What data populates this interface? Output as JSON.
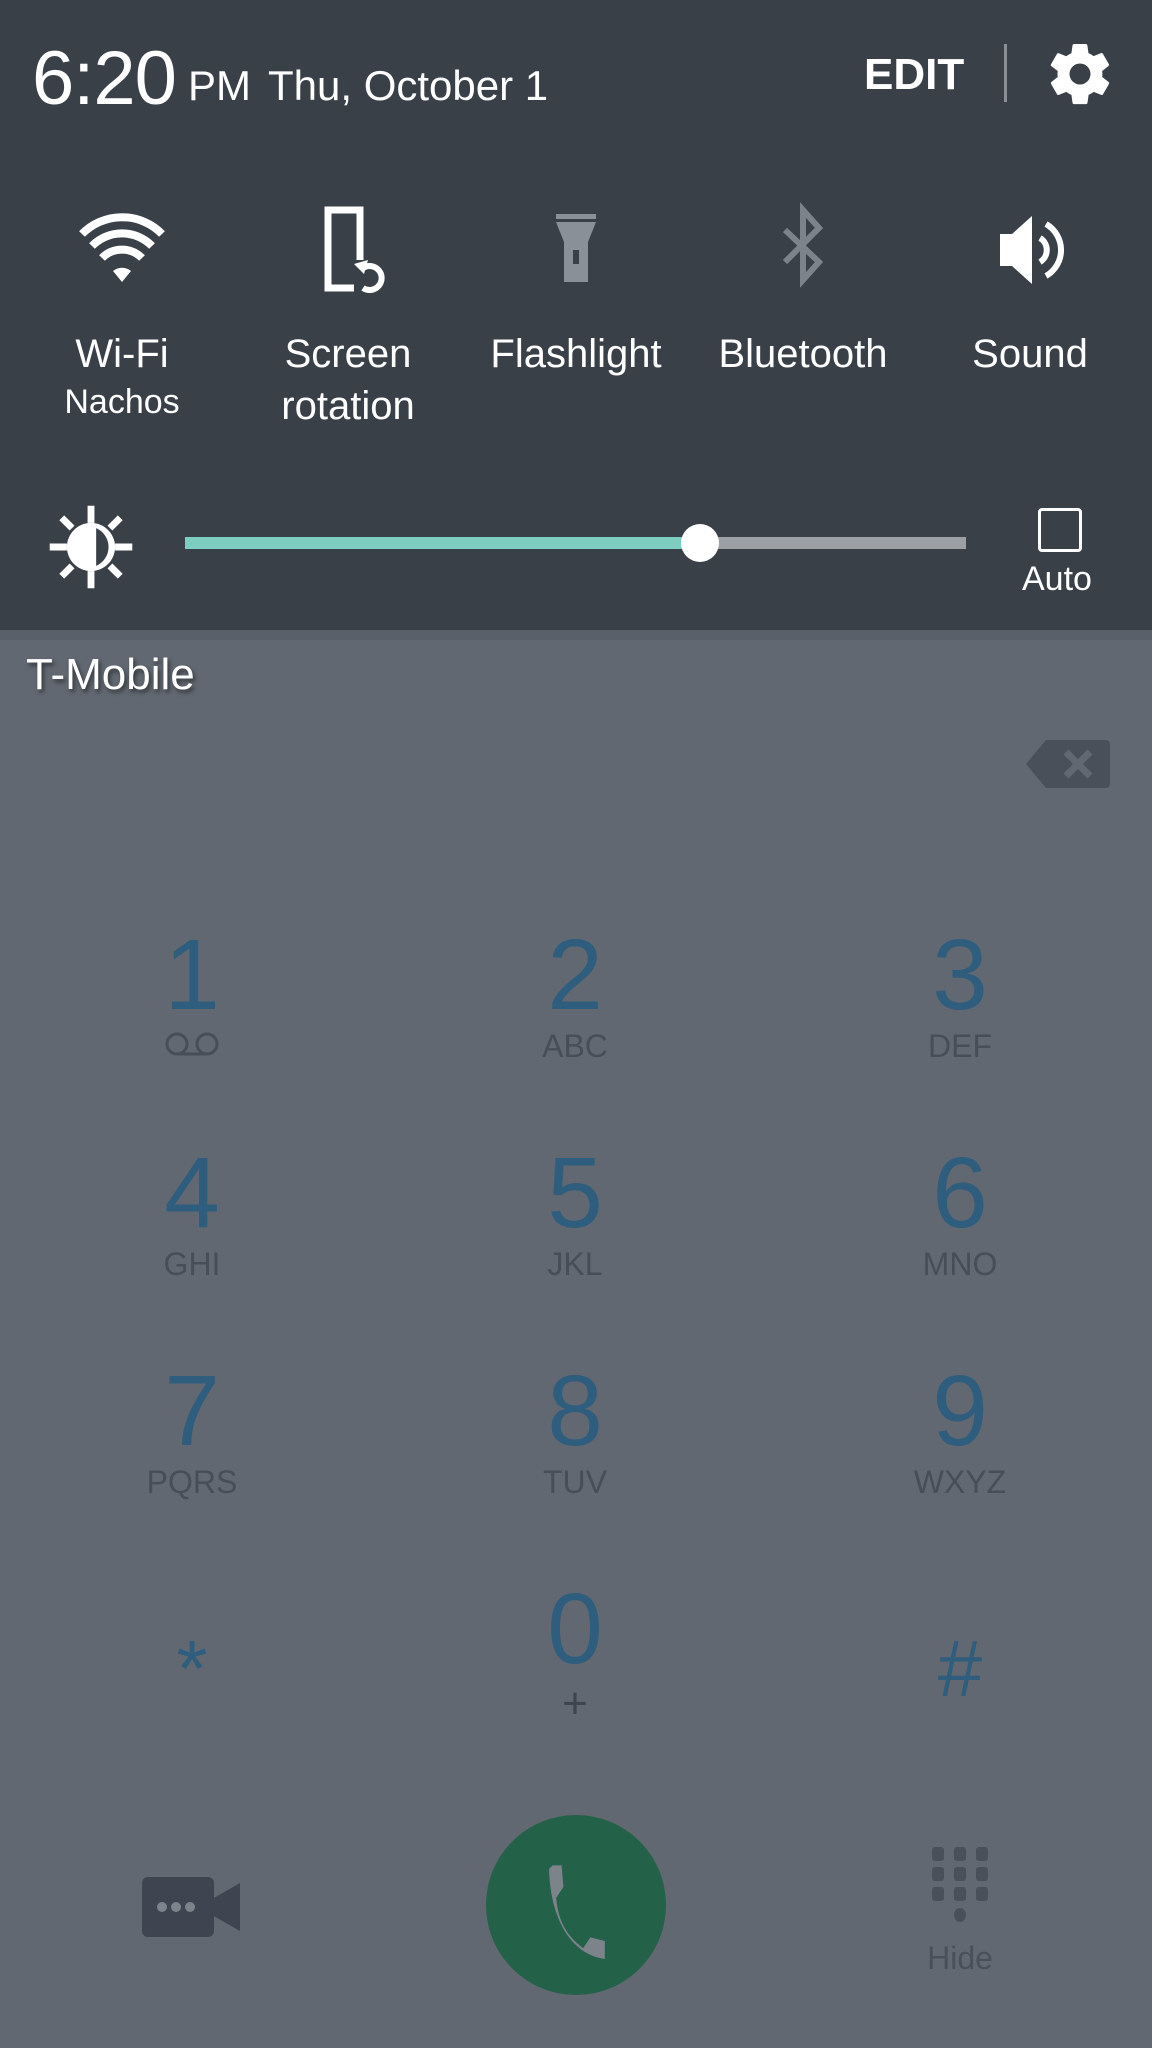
{
  "status": {
    "time": "6:20",
    "ampm": "PM",
    "date": "Thu, October 1",
    "edit_label": "EDIT",
    "settings_icon": "gear-icon"
  },
  "quick_settings": {
    "tiles": [
      {
        "label": "Wi-Fi",
        "sublabel": "Nachos",
        "icon": "wifi-icon",
        "state": "on"
      },
      {
        "label": "Screen\nrotation",
        "label_line1": "Screen",
        "label_line2": "rotation",
        "icon": "screen-rotation-icon",
        "state": "on"
      },
      {
        "label": "Flashlight",
        "icon": "flashlight-icon",
        "state": "off"
      },
      {
        "label": "Bluetooth",
        "icon": "bluetooth-icon",
        "state": "off"
      },
      {
        "label": "Sound",
        "icon": "volume-icon",
        "state": "on"
      }
    ],
    "brightness": {
      "value": 0.66,
      "auto_label": "Auto",
      "auto_checked": false,
      "fill_color": "#7ecdc3"
    }
  },
  "dialer": {
    "carrier": "T-Mobile",
    "keys": [
      {
        "digit": "1",
        "letters": "",
        "icon": "voicemail-icon"
      },
      {
        "digit": "2",
        "letters": "ABC"
      },
      {
        "digit": "3",
        "letters": "DEF"
      },
      {
        "digit": "4",
        "letters": "GHI"
      },
      {
        "digit": "5",
        "letters": "JKL"
      },
      {
        "digit": "6",
        "letters": "MNO"
      },
      {
        "digit": "7",
        "letters": "PQRS"
      },
      {
        "digit": "8",
        "letters": "TUV"
      },
      {
        "digit": "9",
        "letters": "WXYZ"
      },
      {
        "digit": "*",
        "letters": ""
      },
      {
        "digit": "0",
        "letters": "+"
      },
      {
        "digit": "#",
        "letters": ""
      }
    ],
    "hide_label": "Hide",
    "call_color": "#236149"
  }
}
